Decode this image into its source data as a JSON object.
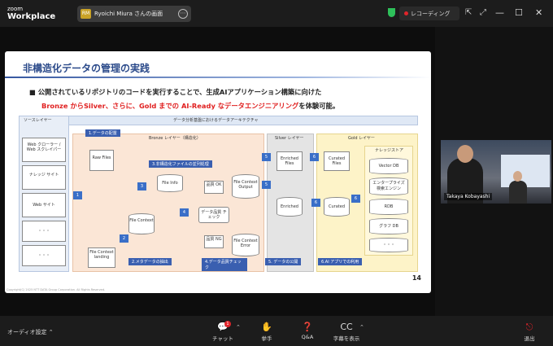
{
  "app": {
    "logo_top": "zoom",
    "logo_bottom": "Workplace"
  },
  "share_tab": {
    "avatar": "RM",
    "label": "Ryoichi Miura さんの画面",
    "more": "⋯"
  },
  "recording": {
    "label": "レコーディング"
  },
  "window_controls": {
    "minimize": "—",
    "maximize": "☐",
    "close": "✕"
  },
  "slide": {
    "title": "非構造化データの管理の実践",
    "bullet_line1": "■  公開されているリポジトリのコードを実行することで、生成AIアプリケーション構築に向けた",
    "bullet_line2_red": "Bronze からSilver、さらに、Gold までの AI-Ready なデータエンジニアリング",
    "bullet_line2_tail": "を体験可能。",
    "page_number": "14",
    "copyright": "Copyright(C) 2025 NTT DATA Group Corporation. All Rights Reserved.",
    "diagram": {
      "header": "データ分析基盤におけるデータアーキテクチャ",
      "source_layer": "ソースレイヤー",
      "sources": [
        "Web クローラー / Web スクレイパー",
        "ナレッジ サイト",
        "Web サイト",
        "・・・",
        "・・・"
      ],
      "bronze_layer": "Bronze レイヤー（構造化）",
      "silver_layer": "Silver レイヤー",
      "gold_layer": "Gold レイヤー",
      "step1": "1.データの配置",
      "step2": "2.メタデータの抽出",
      "step3": "3.非構造化ファイルの並列処理",
      "step4": "4.データ品質チェック",
      "step5": "5. データの公開",
      "step6": "6.AI アプリでの利用",
      "raw_files": "Raw Files",
      "file_context_landing": "File Context landing",
      "file_info": "File Info",
      "file_context": "File Context",
      "quality_ok": "品質 OK",
      "quality_ng": "品質 NG",
      "quality_check": "データ品質 チェック",
      "fc_output": "File Context Output",
      "fc_error": "File Context Error",
      "enriched_files": "Enriched Files",
      "enriched": "Enriched",
      "curated_files": "Curated Files",
      "curated": "Curated",
      "knowledge_store": "ナレッジストア",
      "stores": [
        "Vector DB",
        "エンタープライズ 検索エンジン",
        "RDB",
        "グラフ DB",
        "・・・"
      ],
      "nodes": [
        "1",
        "2",
        "3",
        "4",
        "5",
        "5",
        "6",
        "6",
        "6"
      ]
    }
  },
  "participant": {
    "name": "Takaya Kobayashi"
  },
  "bottom": {
    "audio_settings": "オーディオ設定",
    "chat": "チャット",
    "chat_badge": "1",
    "raise_hand": "挙手",
    "qa": "Q&A",
    "captions": "字幕を表示",
    "leave": "退出"
  }
}
